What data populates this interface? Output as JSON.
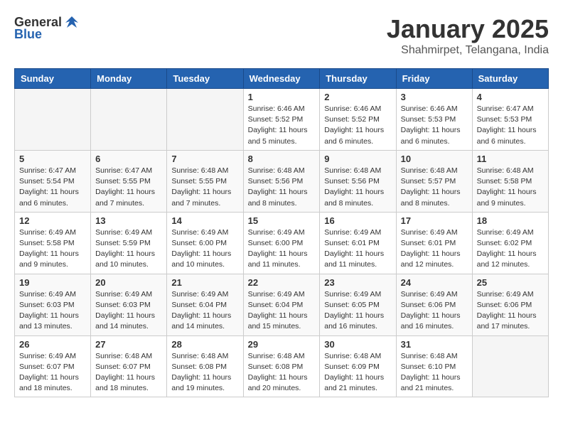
{
  "header": {
    "logo_general": "General",
    "logo_blue": "Blue",
    "month_title": "January 2025",
    "location": "Shahmirpet, Telangana, India"
  },
  "weekdays": [
    "Sunday",
    "Monday",
    "Tuesday",
    "Wednesday",
    "Thursday",
    "Friday",
    "Saturday"
  ],
  "weeks": [
    [
      {
        "day": "",
        "info": ""
      },
      {
        "day": "",
        "info": ""
      },
      {
        "day": "",
        "info": ""
      },
      {
        "day": "1",
        "info": "Sunrise: 6:46 AM\nSunset: 5:52 PM\nDaylight: 11 hours\nand 5 minutes."
      },
      {
        "day": "2",
        "info": "Sunrise: 6:46 AM\nSunset: 5:52 PM\nDaylight: 11 hours\nand 6 minutes."
      },
      {
        "day": "3",
        "info": "Sunrise: 6:46 AM\nSunset: 5:53 PM\nDaylight: 11 hours\nand 6 minutes."
      },
      {
        "day": "4",
        "info": "Sunrise: 6:47 AM\nSunset: 5:53 PM\nDaylight: 11 hours\nand 6 minutes."
      }
    ],
    [
      {
        "day": "5",
        "info": "Sunrise: 6:47 AM\nSunset: 5:54 PM\nDaylight: 11 hours\nand 6 minutes."
      },
      {
        "day": "6",
        "info": "Sunrise: 6:47 AM\nSunset: 5:55 PM\nDaylight: 11 hours\nand 7 minutes."
      },
      {
        "day": "7",
        "info": "Sunrise: 6:48 AM\nSunset: 5:55 PM\nDaylight: 11 hours\nand 7 minutes."
      },
      {
        "day": "8",
        "info": "Sunrise: 6:48 AM\nSunset: 5:56 PM\nDaylight: 11 hours\nand 8 minutes."
      },
      {
        "day": "9",
        "info": "Sunrise: 6:48 AM\nSunset: 5:56 PM\nDaylight: 11 hours\nand 8 minutes."
      },
      {
        "day": "10",
        "info": "Sunrise: 6:48 AM\nSunset: 5:57 PM\nDaylight: 11 hours\nand 8 minutes."
      },
      {
        "day": "11",
        "info": "Sunrise: 6:48 AM\nSunset: 5:58 PM\nDaylight: 11 hours\nand 9 minutes."
      }
    ],
    [
      {
        "day": "12",
        "info": "Sunrise: 6:49 AM\nSunset: 5:58 PM\nDaylight: 11 hours\nand 9 minutes."
      },
      {
        "day": "13",
        "info": "Sunrise: 6:49 AM\nSunset: 5:59 PM\nDaylight: 11 hours\nand 10 minutes."
      },
      {
        "day": "14",
        "info": "Sunrise: 6:49 AM\nSunset: 6:00 PM\nDaylight: 11 hours\nand 10 minutes."
      },
      {
        "day": "15",
        "info": "Sunrise: 6:49 AM\nSunset: 6:00 PM\nDaylight: 11 hours\nand 11 minutes."
      },
      {
        "day": "16",
        "info": "Sunrise: 6:49 AM\nSunset: 6:01 PM\nDaylight: 11 hours\nand 11 minutes."
      },
      {
        "day": "17",
        "info": "Sunrise: 6:49 AM\nSunset: 6:01 PM\nDaylight: 11 hours\nand 12 minutes."
      },
      {
        "day": "18",
        "info": "Sunrise: 6:49 AM\nSunset: 6:02 PM\nDaylight: 11 hours\nand 12 minutes."
      }
    ],
    [
      {
        "day": "19",
        "info": "Sunrise: 6:49 AM\nSunset: 6:03 PM\nDaylight: 11 hours\nand 13 minutes."
      },
      {
        "day": "20",
        "info": "Sunrise: 6:49 AM\nSunset: 6:03 PM\nDaylight: 11 hours\nand 14 minutes."
      },
      {
        "day": "21",
        "info": "Sunrise: 6:49 AM\nSunset: 6:04 PM\nDaylight: 11 hours\nand 14 minutes."
      },
      {
        "day": "22",
        "info": "Sunrise: 6:49 AM\nSunset: 6:04 PM\nDaylight: 11 hours\nand 15 minutes."
      },
      {
        "day": "23",
        "info": "Sunrise: 6:49 AM\nSunset: 6:05 PM\nDaylight: 11 hours\nand 16 minutes."
      },
      {
        "day": "24",
        "info": "Sunrise: 6:49 AM\nSunset: 6:06 PM\nDaylight: 11 hours\nand 16 minutes."
      },
      {
        "day": "25",
        "info": "Sunrise: 6:49 AM\nSunset: 6:06 PM\nDaylight: 11 hours\nand 17 minutes."
      }
    ],
    [
      {
        "day": "26",
        "info": "Sunrise: 6:49 AM\nSunset: 6:07 PM\nDaylight: 11 hours\nand 18 minutes."
      },
      {
        "day": "27",
        "info": "Sunrise: 6:48 AM\nSunset: 6:07 PM\nDaylight: 11 hours\nand 18 minutes."
      },
      {
        "day": "28",
        "info": "Sunrise: 6:48 AM\nSunset: 6:08 PM\nDaylight: 11 hours\nand 19 minutes."
      },
      {
        "day": "29",
        "info": "Sunrise: 6:48 AM\nSunset: 6:08 PM\nDaylight: 11 hours\nand 20 minutes."
      },
      {
        "day": "30",
        "info": "Sunrise: 6:48 AM\nSunset: 6:09 PM\nDaylight: 11 hours\nand 21 minutes."
      },
      {
        "day": "31",
        "info": "Sunrise: 6:48 AM\nSunset: 6:10 PM\nDaylight: 11 hours\nand 21 minutes."
      },
      {
        "day": "",
        "info": ""
      }
    ]
  ]
}
